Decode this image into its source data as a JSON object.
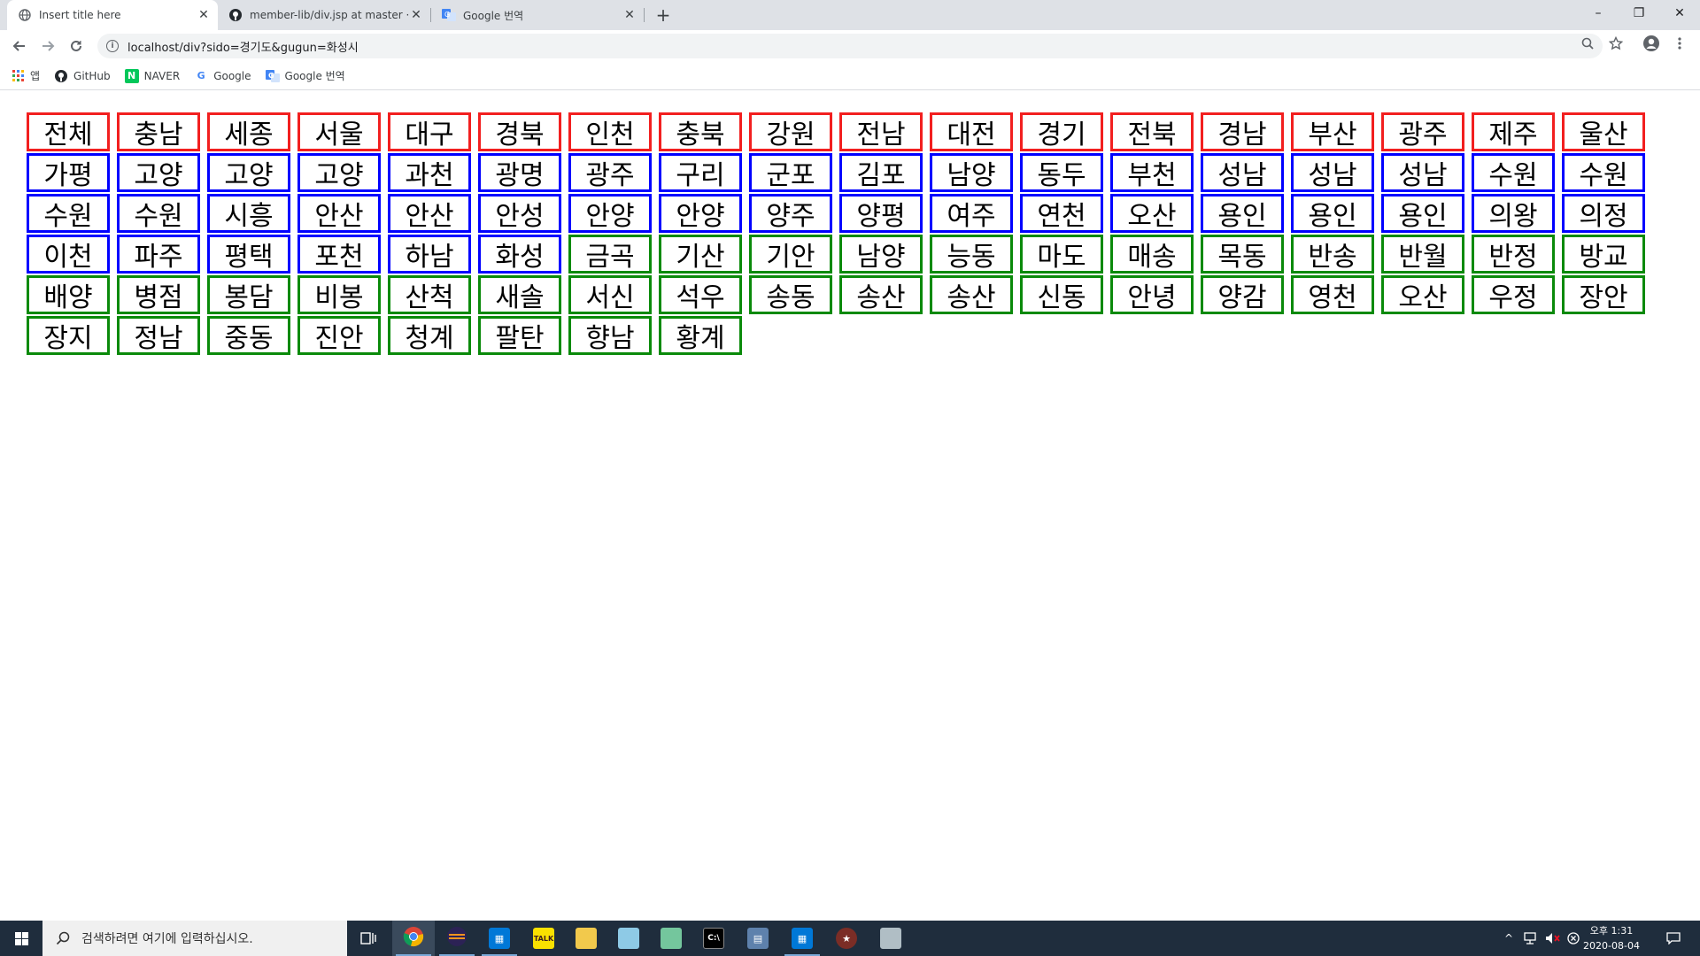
{
  "browser": {
    "tabs": [
      {
        "title": "Insert title here",
        "active": true,
        "icon": "globe-icon"
      },
      {
        "title": "member-lib/div.jsp at master · F",
        "active": false,
        "icon": "github-icon"
      },
      {
        "title": "Google 번역",
        "active": false,
        "icon": "google-translate-icon"
      }
    ],
    "url": "localhost/div?sido=경기도&gugun=화성시",
    "bookmarks": [
      {
        "label": "앱",
        "icon": "apps-icon"
      },
      {
        "label": "GitHub",
        "icon": "github-icon"
      },
      {
        "label": "NAVER",
        "icon": "naver-icon"
      },
      {
        "label": "Google",
        "icon": "google-icon"
      },
      {
        "label": "Google 번역",
        "icon": "google-translate-icon"
      }
    ],
    "window_controls": {
      "minimize": "–",
      "restore": "❐",
      "close": "✕"
    }
  },
  "page": {
    "rows": [
      {
        "color": "red",
        "items": [
          "전체",
          "충남",
          "세종",
          "서울",
          "대구",
          "경북",
          "인천",
          "충북",
          "강원",
          "전남",
          "대전",
          "경기",
          "전북",
          "경남",
          "부산",
          "광주",
          "제주",
          "울산"
        ]
      },
      {
        "color": "blue",
        "items": [
          "가평",
          "고양",
          "고양",
          "고양",
          "과천",
          "광명",
          "광주",
          "구리",
          "군포",
          "김포",
          "남양",
          "동두",
          "부천",
          "성남",
          "성남",
          "성남",
          "수원",
          "수원"
        ]
      },
      {
        "color": "blue",
        "items": [
          "수원",
          "수원",
          "시흥",
          "안산",
          "안산",
          "안성",
          "안양",
          "안양",
          "양주",
          "양평",
          "여주",
          "연천",
          "오산",
          "용인",
          "용인",
          "용인",
          "의왕",
          "의정"
        ]
      },
      {
        "color": "mixed",
        "items": [
          "이천",
          "파주",
          "평택",
          "포천",
          "하남",
          "화성",
          "금곡",
          "기산",
          "기안",
          "남양",
          "능동",
          "마도",
          "매송",
          "목동",
          "반송",
          "반월",
          "반정",
          "방교"
        ],
        "blue_count": 6
      },
      {
        "color": "green",
        "items": [
          "배양",
          "병점",
          "봉담",
          "비봉",
          "산척",
          "새솔",
          "서신",
          "석우",
          "송동",
          "송산",
          "송산",
          "신동",
          "안녕",
          "양감",
          "영천",
          "오산",
          "우정",
          "장안"
        ]
      },
      {
        "color": "green",
        "items": [
          "장지",
          "정남",
          "중동",
          "진안",
          "청계",
          "팔탄",
          "향남",
          "황계"
        ]
      }
    ],
    "colors": {
      "red": "#f21f1f",
      "blue": "#0000ff",
      "green": "#0a8a0a"
    }
  },
  "taskbar": {
    "search_placeholder": "검색하려면 여기에 입력하십시오.",
    "clock_time": "오후 1:31",
    "clock_date": "2020-08-04"
  }
}
